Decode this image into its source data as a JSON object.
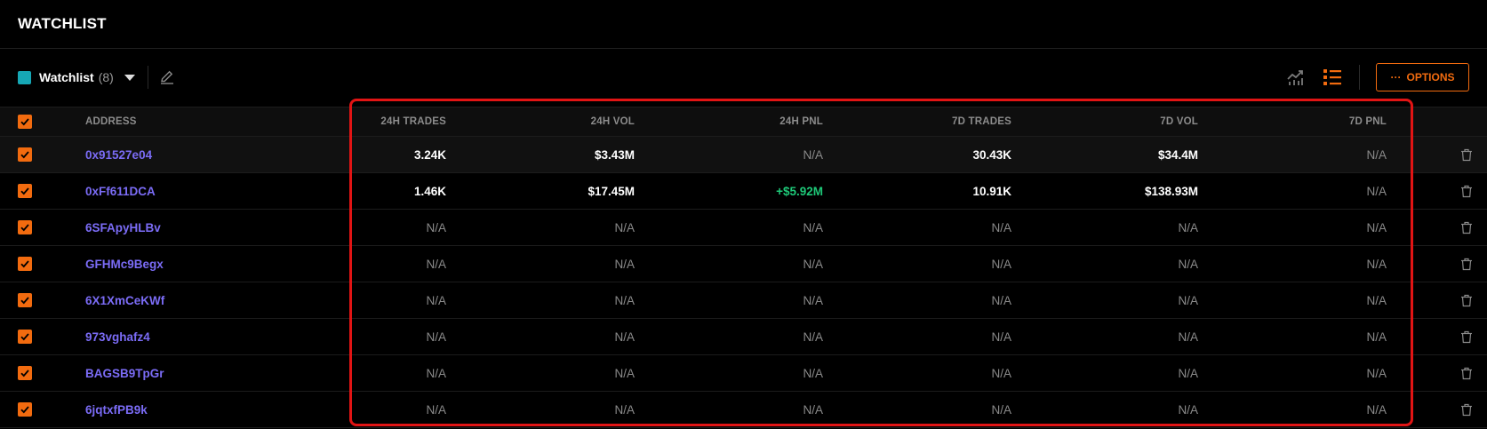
{
  "page": {
    "title": "WATCHLIST"
  },
  "toolbar": {
    "watchlist_name": "Watchlist",
    "watchlist_count": "(8)",
    "options_label": "OPTIONS",
    "colors": {
      "watchlist": "#16a7b5",
      "accent": "#f26b0f"
    }
  },
  "table": {
    "headers": {
      "address": "ADDRESS",
      "trades_24h": "24H TRADES",
      "vol_24h": "24H VOL",
      "pnl_24h": "24H PNL",
      "trades_7d": "7D TRADES",
      "vol_7d": "7D VOL",
      "pnl_7d": "7D PNL"
    },
    "rows": [
      {
        "address": "0x91527e04",
        "trades_24h": "3.24K",
        "vol_24h": "$3.43M",
        "pnl_24h": "N/A",
        "trades_7d": "30.43K",
        "vol_7d": "$34.4M",
        "pnl_7d": "N/A"
      },
      {
        "address": "0xFf611DCA",
        "trades_24h": "1.46K",
        "vol_24h": "$17.45M",
        "pnl_24h": "+$5.92M",
        "trades_7d": "10.91K",
        "vol_7d": "$138.93M",
        "pnl_7d": "N/A"
      },
      {
        "address": "6SFApyHLBv",
        "trades_24h": "N/A",
        "vol_24h": "N/A",
        "pnl_24h": "N/A",
        "trades_7d": "N/A",
        "vol_7d": "N/A",
        "pnl_7d": "N/A"
      },
      {
        "address": "GFHMc9Begx",
        "trades_24h": "N/A",
        "vol_24h": "N/A",
        "pnl_24h": "N/A",
        "trades_7d": "N/A",
        "vol_7d": "N/A",
        "pnl_7d": "N/A"
      },
      {
        "address": "6X1XmCeKWf",
        "trades_24h": "N/A",
        "vol_24h": "N/A",
        "pnl_24h": "N/A",
        "trades_7d": "N/A",
        "vol_7d": "N/A",
        "pnl_7d": "N/A"
      },
      {
        "address": "973vghafz4",
        "trades_24h": "N/A",
        "vol_24h": "N/A",
        "pnl_24h": "N/A",
        "trades_7d": "N/A",
        "vol_7d": "N/A",
        "pnl_7d": "N/A"
      },
      {
        "address": "BAGSB9TpGr",
        "trades_24h": "N/A",
        "vol_24h": "N/A",
        "pnl_24h": "N/A",
        "trades_7d": "N/A",
        "vol_7d": "N/A",
        "pnl_7d": "N/A"
      },
      {
        "address": "6jqtxfPB9k",
        "trades_24h": "N/A",
        "vol_24h": "N/A",
        "pnl_24h": "N/A",
        "trades_7d": "N/A",
        "vol_7d": "N/A",
        "pnl_7d": "N/A"
      }
    ]
  },
  "icons": {
    "header_checkbox": "checkbox-checked-icon",
    "edit": "pencil-icon",
    "chart_view": "chart-view-icon",
    "list_view": "list-view-icon",
    "row_delete": "trash-icon"
  }
}
